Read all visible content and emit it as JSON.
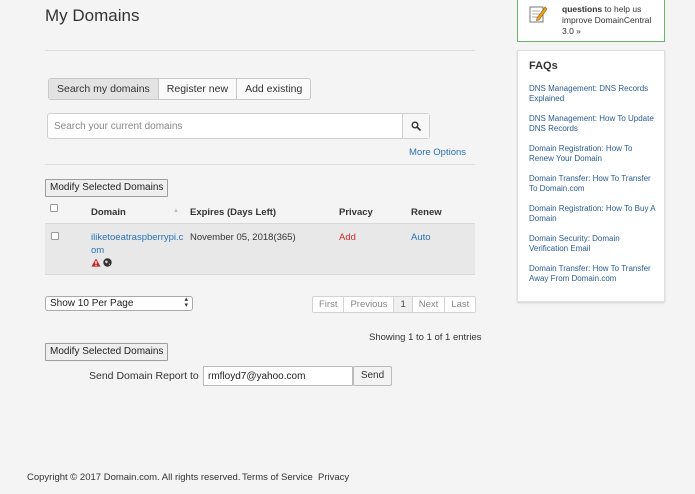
{
  "page": {
    "title": "My Domains"
  },
  "tabs": [
    {
      "label": "Search my domains",
      "active": true
    },
    {
      "label": "Register new",
      "active": false
    },
    {
      "label": "Add existing",
      "active": false
    }
  ],
  "search": {
    "placeholder": "Search your current domains",
    "icon": "search-icon"
  },
  "more_options": "More Options",
  "modify_label": "Modify Selected Domains",
  "table": {
    "columns": {
      "domain": "Domain",
      "expires": "Expires (Days Left)",
      "privacy": "Privacy",
      "renew": "Renew"
    },
    "rows": [
      {
        "domain_line1": "iliketoeatraspberrypi.c",
        "domain_line2": "om",
        "expires": "November 05, 2018(365)",
        "privacy": "Add",
        "renew": "Auto",
        "icons": [
          "warning-icon",
          "globe-icon"
        ]
      }
    ]
  },
  "per_page": "Show 10 Per Page",
  "pager": {
    "first": "First",
    "previous": "Previous",
    "current": "1",
    "next": "Next",
    "last": "Last"
  },
  "showing": "Showing 1 to 1 of 1 entries",
  "report": {
    "label": "Send Domain Report to →",
    "email": "rmfloyd7@yahoo.com",
    "send": "Send"
  },
  "footer": {
    "copyright": "Copyright © 2017  Domain.com. All rights reserved.",
    "terms": "Terms of Service",
    "privacy": "Privacy"
  },
  "promo": {
    "bold": "questions",
    "rest": " to help us improve DomainCentral 3.0 »",
    "icon": "edit-note-icon"
  },
  "faq": {
    "title": "FAQs",
    "items": [
      "DNS Management: DNS Records Explained",
      "DNS Management: How To Update DNS Records",
      "Domain Registration: How To Renew Your Domain",
      "Domain Transfer: How To Transfer To Domain.com",
      "Domain Registration: How To Buy A Domain",
      "Domain Security: Domain Verification Email",
      "Domain Transfer: How To Transfer Away From Domain.com"
    ]
  },
  "colors": {
    "link": "#2a72b5",
    "privacy_add": "#cc2d2d",
    "promo_border": "#6bb36b"
  }
}
